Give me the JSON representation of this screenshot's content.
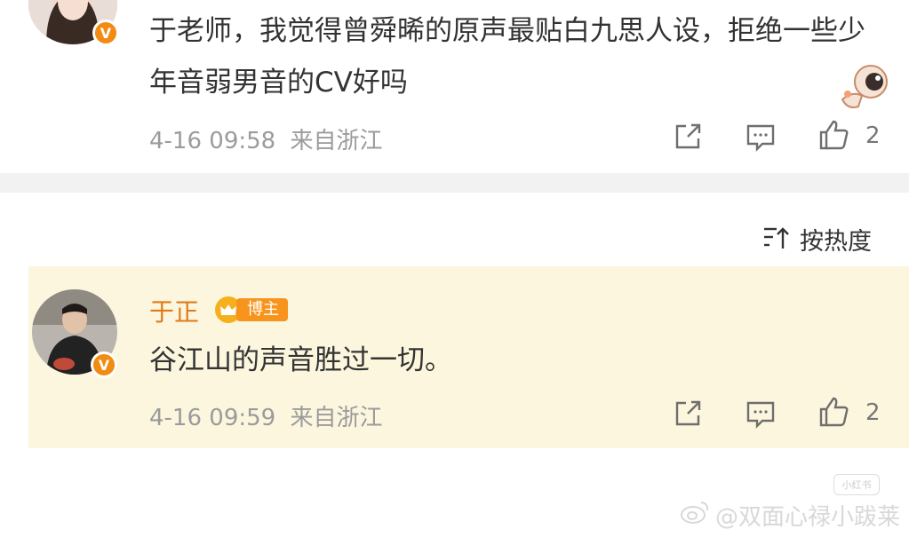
{
  "post": {
    "text": "于老师，我觉得曾舜晞的原声最贴白九思人设，拒绝一些少年音弱男音的CV好吗",
    "timestamp": "4-16 09:58",
    "location": "来自浙江",
    "like_count": "2",
    "verified_mark": "V"
  },
  "sort": {
    "label": "按热度"
  },
  "reply": {
    "author": "于正",
    "author_badge": "博主",
    "text": "谷江山的声音胜过一切。",
    "timestamp": "4-16 09:59",
    "location": "来自浙江",
    "like_count": "2",
    "verified_mark": "V"
  },
  "watermark": {
    "text": "@双面心禄小跋莱",
    "mini": "小红书"
  },
  "icons": {
    "share": "share-icon",
    "comment": "comment-icon",
    "like": "thumbs-up-icon",
    "sort": "sort-icon",
    "sticker": "astronaut-sticker-icon"
  },
  "colors": {
    "author_name": "#e07a18",
    "reply_bg": "#fbf6dd",
    "badge": "#f7941d",
    "verified": "#f28b12"
  }
}
